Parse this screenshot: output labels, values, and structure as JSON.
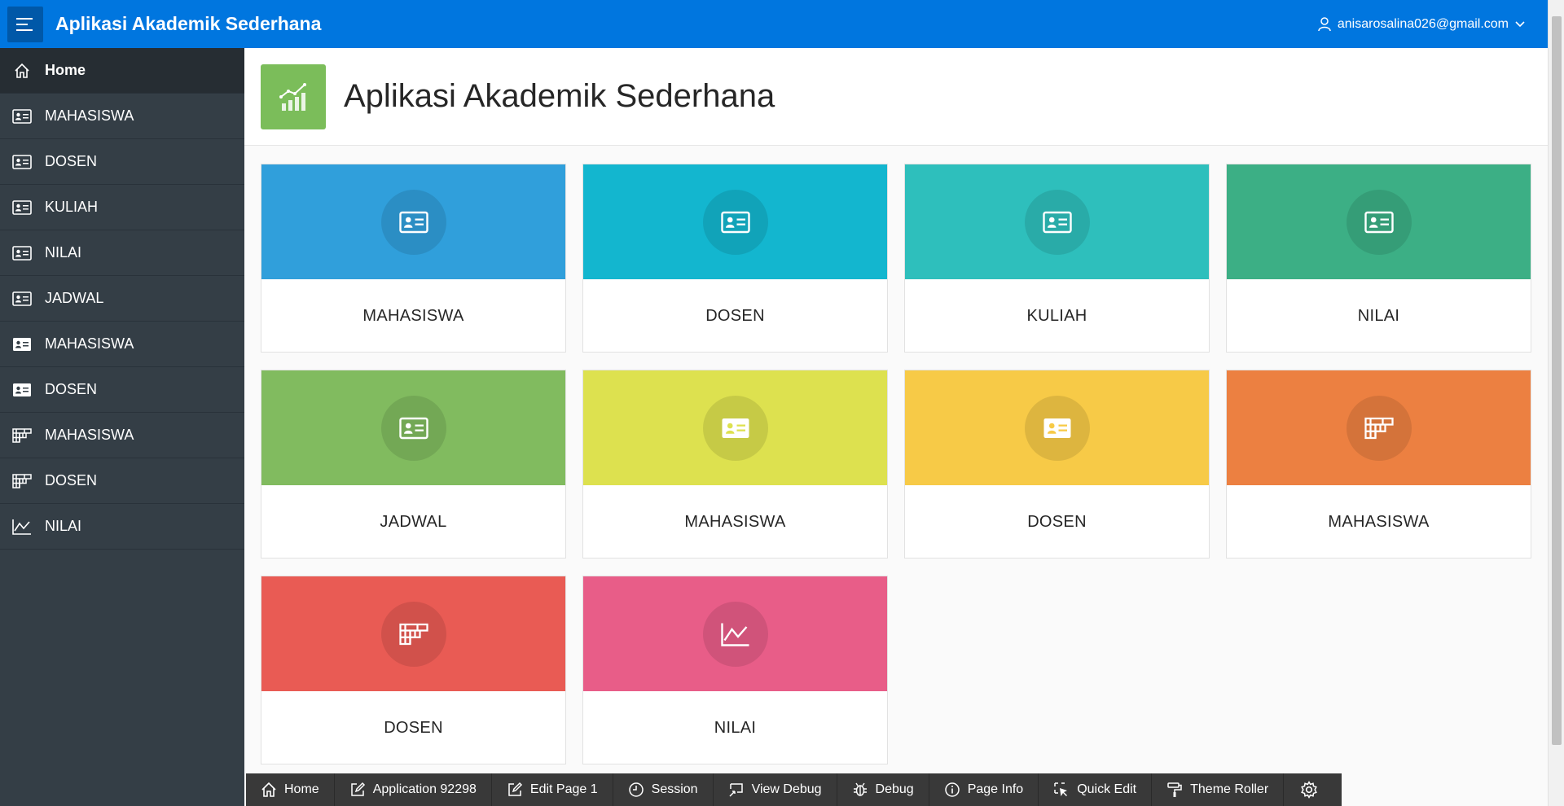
{
  "header": {
    "title": "Aplikasi Akademik Sederhana",
    "user_email": "anisarosalina026@gmail.com"
  },
  "sidebar": {
    "items": [
      {
        "label": "Home",
        "icon": "home-icon",
        "active": true
      },
      {
        "label": "MAHASISWA",
        "icon": "id-card-icon"
      },
      {
        "label": "DOSEN",
        "icon": "id-card-icon"
      },
      {
        "label": "KULIAH",
        "icon": "id-card-icon"
      },
      {
        "label": "NILAI",
        "icon": "id-card-icon"
      },
      {
        "label": "JADWAL",
        "icon": "id-card-icon"
      },
      {
        "label": "MAHASISWA",
        "icon": "id-card-solid-icon"
      },
      {
        "label": "DOSEN",
        "icon": "id-card-solid-icon"
      },
      {
        "label": "MAHASISWA",
        "icon": "table-icon"
      },
      {
        "label": "DOSEN",
        "icon": "table-icon"
      },
      {
        "label": "NILAI",
        "icon": "line-chart-icon"
      }
    ]
  },
  "page": {
    "title": "Aplikasi Akademik Sederhana",
    "icon": "chart-up-icon"
  },
  "cards": [
    {
      "label": "MAHASISWA",
      "color": "#309fdb",
      "icon": "id-card-icon"
    },
    {
      "label": "DOSEN",
      "color": "#13b6cf",
      "icon": "id-card-icon"
    },
    {
      "label": "KULIAH",
      "color": "#2ebfbc",
      "icon": "id-card-icon"
    },
    {
      "label": "NILAI",
      "color": "#3caf85",
      "icon": "id-card-icon"
    },
    {
      "label": "JADWAL",
      "color": "#81bb5f",
      "icon": "id-card-icon"
    },
    {
      "label": "MAHASISWA",
      "color": "#dde14f",
      "icon": "id-card-solid-icon"
    },
    {
      "label": "DOSEN",
      "color": "#f7ca47",
      "icon": "id-card-solid-icon"
    },
    {
      "label": "MAHASISWA",
      "color": "#ec8041",
      "icon": "table-icon"
    },
    {
      "label": "DOSEN",
      "color": "#e95b54",
      "icon": "table-icon"
    },
    {
      "label": "NILAI",
      "color": "#e85d88",
      "icon": "line-chart-icon"
    }
  ],
  "devbar": {
    "items": [
      {
        "label": "Home",
        "icon": "home-icon"
      },
      {
        "label": "Application 92298",
        "icon": "edit-icon"
      },
      {
        "label": "Edit Page 1",
        "icon": "edit-icon"
      },
      {
        "label": "Session",
        "icon": "clock-icon"
      },
      {
        "label": "View Debug",
        "icon": "view-debug-icon"
      },
      {
        "label": "Debug",
        "icon": "bug-icon"
      },
      {
        "label": "Page Info",
        "icon": "info-icon"
      },
      {
        "label": "Quick Edit",
        "icon": "quick-edit-icon"
      },
      {
        "label": "Theme Roller",
        "icon": "paint-roller-icon"
      }
    ],
    "settings_icon": "gear-icon"
  }
}
